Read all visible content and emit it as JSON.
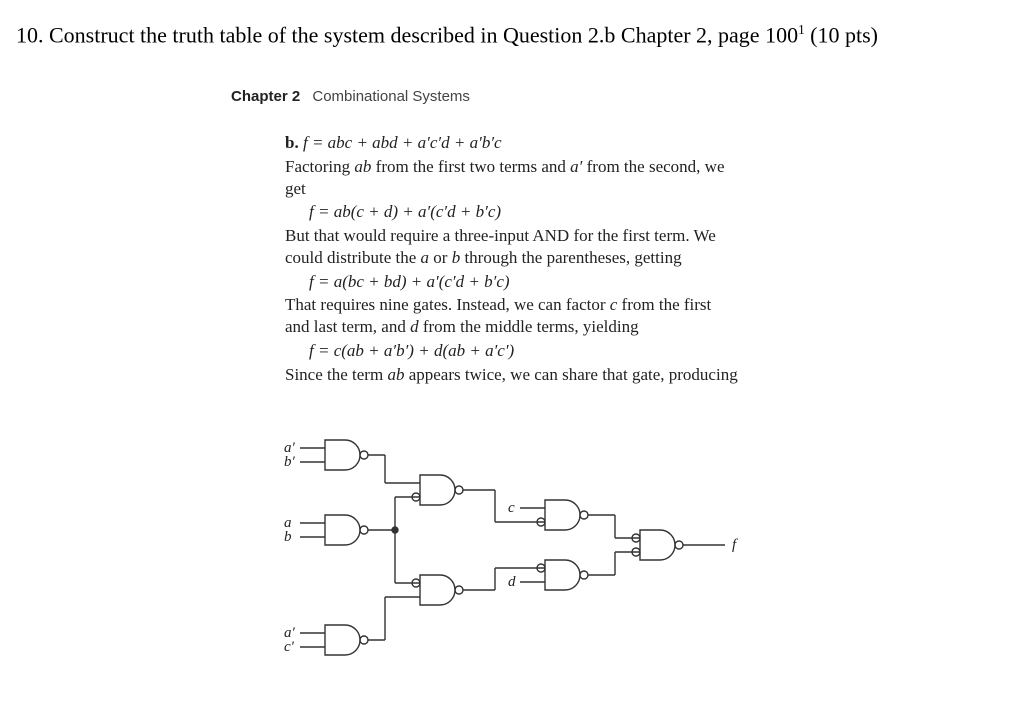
{
  "question": {
    "number": "10.",
    "text_before_sup": "Construct the truth table of the system described in Question 2.b Chapter 2, page 100",
    "sup": "1",
    "text_after_sup": " (10 pts)"
  },
  "chapter_header": {
    "label": "Chapter 2",
    "title": "Combinational Systems"
  },
  "body": {
    "line_b_prefix": "b.",
    "eq1": "f = abc + abd + a′c′d + a′b′c",
    "p1a": "Factoring ",
    "p1_i1": "ab",
    "p1b": " from the first two terms and ",
    "p1_i2": "a′",
    "p1c": " from the second, we get",
    "eq2": "f = ab(c + d) + a′(c′d + b′c)",
    "p2a": "But that would require a three-input AND for the first term. We could distribute the ",
    "p2_i1": "a",
    "p2b": " or ",
    "p2_i2": "b",
    "p2c": " through the parentheses, getting",
    "eq3": "f = a(bc + bd) + a′(c′d + b′c)",
    "p3a": "That requires nine gates. Instead, we can factor ",
    "p3_i1": "c",
    "p3b": " from the first and last term, and ",
    "p3_i2": "d",
    "p3c": " from the middle terms, yielding",
    "eq4": "f = c(ab + a′b′) + d(ab + a′c′)",
    "p4a": "Since the term ",
    "p4_i1": "ab",
    "p4b": " appears twice, we can share that gate, producing"
  },
  "circuit_labels": {
    "a_prime_top": "a′",
    "b_prime": "b′",
    "a": "a",
    "b": "b",
    "a_prime_bot": "a′",
    "c_prime": "c′",
    "c": "c",
    "d": "d",
    "f": "f"
  }
}
